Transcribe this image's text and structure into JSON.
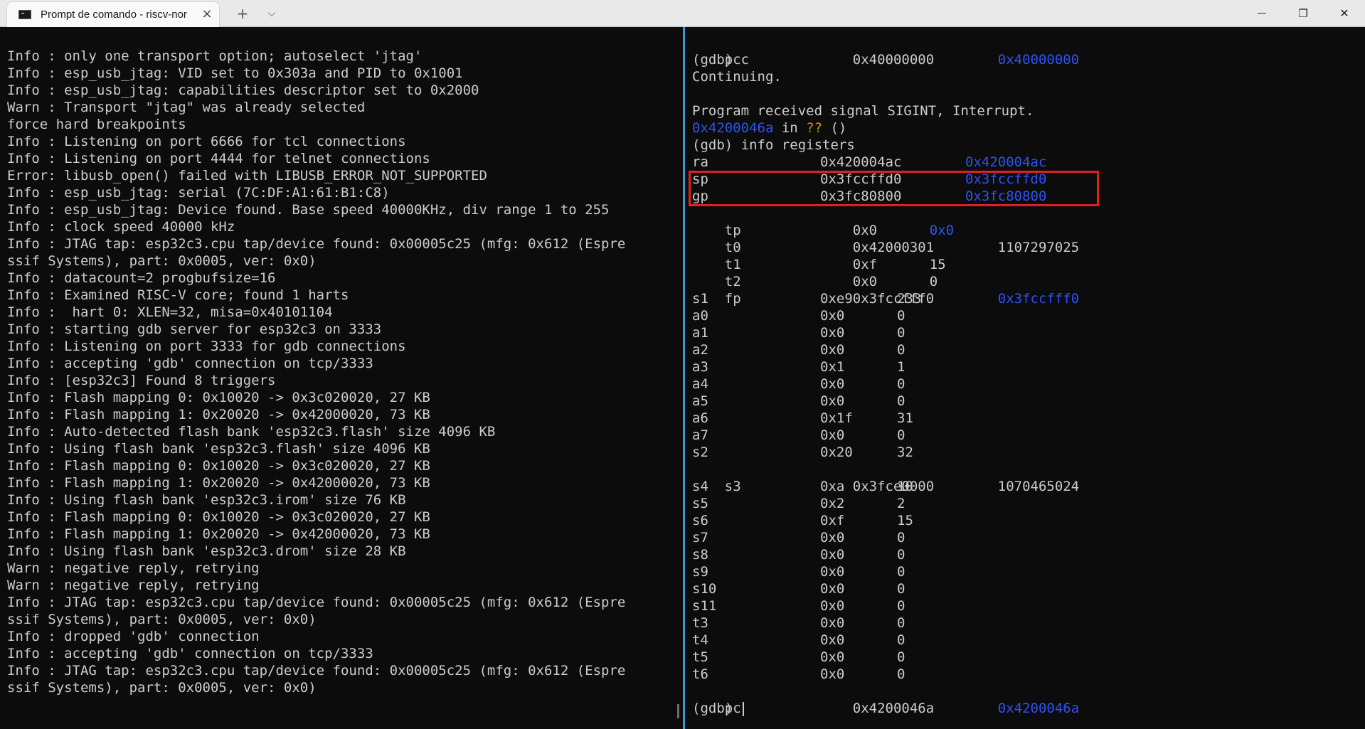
{
  "window": {
    "tab_title": "Prompt de comando - riscv-nor",
    "tab_close": "×",
    "new_tab": "+",
    "dropdown": "⌵",
    "minimize": "—",
    "restore": "❐",
    "close": "✕"
  },
  "left_pane": {
    "lines": [
      "Info : only one transport option; autoselect 'jtag'",
      "Info : esp_usb_jtag: VID set to 0x303a and PID to 0x1001",
      "Info : esp_usb_jtag: capabilities descriptor set to 0x2000",
      "Warn : Transport \"jtag\" was already selected",
      "force hard breakpoints",
      "Info : Listening on port 6666 for tcl connections",
      "Info : Listening on port 4444 for telnet connections",
      "Error: libusb_open() failed with LIBUSB_ERROR_NOT_SUPPORTED",
      "Info : esp_usb_jtag: serial (7C:DF:A1:61:B1:C8)",
      "Info : esp_usb_jtag: Device found. Base speed 40000KHz, div range 1 to 255",
      "Info : clock speed 40000 kHz",
      "Info : JTAG tap: esp32c3.cpu tap/device found: 0x00005c25 (mfg: 0x612 (Espre",
      "ssif Systems), part: 0x0005, ver: 0x0)",
      "Info : datacount=2 progbufsize=16",
      "Info : Examined RISC-V core; found 1 harts",
      "Info :  hart 0: XLEN=32, misa=0x40101104",
      "Info : starting gdb server for esp32c3 on 3333",
      "Info : Listening on port 3333 for gdb connections",
      "Info : accepting 'gdb' connection on tcp/3333",
      "Info : [esp32c3] Found 8 triggers",
      "Info : Flash mapping 0: 0x10020 -> 0x3c020020, 27 KB",
      "Info : Flash mapping 1: 0x20020 -> 0x42000020, 73 KB",
      "Info : Auto-detected flash bank 'esp32c3.flash' size 4096 KB",
      "Info : Using flash bank 'esp32c3.flash' size 4096 KB",
      "Info : Flash mapping 0: 0x10020 -> 0x3c020020, 27 KB",
      "Info : Flash mapping 1: 0x20020 -> 0x42000020, 73 KB",
      "Info : Using flash bank 'esp32c3.irom' size 76 KB",
      "Info : Flash mapping 0: 0x10020 -> 0x3c020020, 27 KB",
      "Info : Flash mapping 1: 0x20020 -> 0x42000020, 73 KB",
      "Info : Using flash bank 'esp32c3.drom' size 28 KB",
      "Warn : negative reply, retrying",
      "Warn : negative reply, retrying",
      "Info : JTAG tap: esp32c3.cpu tap/device found: 0x00005c25 (mfg: 0x612 (Espre",
      "ssif Systems), part: 0x0005, ver: 0x0)",
      "Info : dropped 'gdb' connection",
      "Info : accepting 'gdb' connection on tcp/3333",
      "Info : JTAG tap: esp32c3.cpu tap/device found: 0x00005c25 (mfg: 0x612 (Espre",
      "ssif Systems), part: 0x0005, ver: 0x0)"
    ]
  },
  "right_pane": {
    "pc_first": {
      "name": "pc",
      "hex": "0x40000000",
      "natural": "0x40000000"
    },
    "cmd_continue": "(gdb) c",
    "continuing": "Continuing.",
    "signal_line": "Program received signal SIGINT, Interrupt.",
    "frame_addr": "0x4200046a",
    "frame_in": " in ",
    "frame_unknown": "??",
    "frame_args": " ()",
    "cmd_info": "(gdb) info registers",
    "registers_wide": [
      {
        "name": "ra",
        "hex": "0x420004ac",
        "natural": "0x420004ac",
        "blue": true
      },
      {
        "name": "sp",
        "hex": "0x3fccffd0",
        "natural": "0x3fccffd0",
        "blue": true
      },
      {
        "name": "gp",
        "hex": "0x3fc80800",
        "natural": "0x3fc80800",
        "blue": true
      }
    ],
    "reg_tp": {
      "name": "tp",
      "hex": "0x0",
      "natural": "0x0"
    },
    "reg_t0": {
      "name": "t0",
      "hex": "0x42000301",
      "natural": "1107297025"
    },
    "reg_t1": {
      "name": "t1",
      "hex": "0xf",
      "natural": "15"
    },
    "reg_t2": {
      "name": "t2",
      "hex": "0x0",
      "natural": "0"
    },
    "reg_fp": {
      "name": "fp",
      "hex": "0x3fccfff0",
      "natural": "0x3fccfff0"
    },
    "registers_short_1": [
      {
        "name": "s1",
        "hex": "0xe9",
        "natural": "233"
      },
      {
        "name": "a0",
        "hex": "0x0",
        "natural": "0"
      },
      {
        "name": "a1",
        "hex": "0x0",
        "natural": "0"
      },
      {
        "name": "a2",
        "hex": "0x0",
        "natural": "0"
      },
      {
        "name": "a3",
        "hex": "0x1",
        "natural": "1"
      },
      {
        "name": "a4",
        "hex": "0x0",
        "natural": "0"
      },
      {
        "name": "a5",
        "hex": "0x0",
        "natural": "0"
      },
      {
        "name": "a6",
        "hex": "0x1f",
        "natural": "31"
      },
      {
        "name": "a7",
        "hex": "0x0",
        "natural": "0"
      },
      {
        "name": "s2",
        "hex": "0x20",
        "natural": "32"
      }
    ],
    "reg_s3": {
      "name": "s3",
      "hex": "0x3fce0000",
      "natural": "1070465024"
    },
    "registers_short_2": [
      {
        "name": "s4",
        "hex": "0xa",
        "natural": "10"
      },
      {
        "name": "s5",
        "hex": "0x2",
        "natural": "2"
      },
      {
        "name": "s6",
        "hex": "0xf",
        "natural": "15"
      },
      {
        "name": "s7",
        "hex": "0x0",
        "natural": "0"
      },
      {
        "name": "s8",
        "hex": "0x0",
        "natural": "0"
      },
      {
        "name": "s9",
        "hex": "0x0",
        "natural": "0"
      },
      {
        "name": "s10",
        "hex": "0x0",
        "natural": "0"
      },
      {
        "name": "s11",
        "hex": "0x0",
        "natural": "0"
      },
      {
        "name": "t3",
        "hex": "0x0",
        "natural": "0"
      },
      {
        "name": "t4",
        "hex": "0x0",
        "natural": "0"
      },
      {
        "name": "t5",
        "hex": "0x0",
        "natural": "0"
      },
      {
        "name": "t6",
        "hex": "0x0",
        "natural": "0"
      }
    ],
    "pc_last": {
      "name": "pc",
      "hex": "0x4200046a",
      "natural": "0x4200046a"
    },
    "prompt": "(gdb) "
  },
  "colors": {
    "background": "#0c0c0c",
    "text": "#cccccc",
    "address_blue": "#2f52f2",
    "unknown_yellow": "#c19c00",
    "highlight_red": "#e02020",
    "divider": "#3a96dd"
  }
}
